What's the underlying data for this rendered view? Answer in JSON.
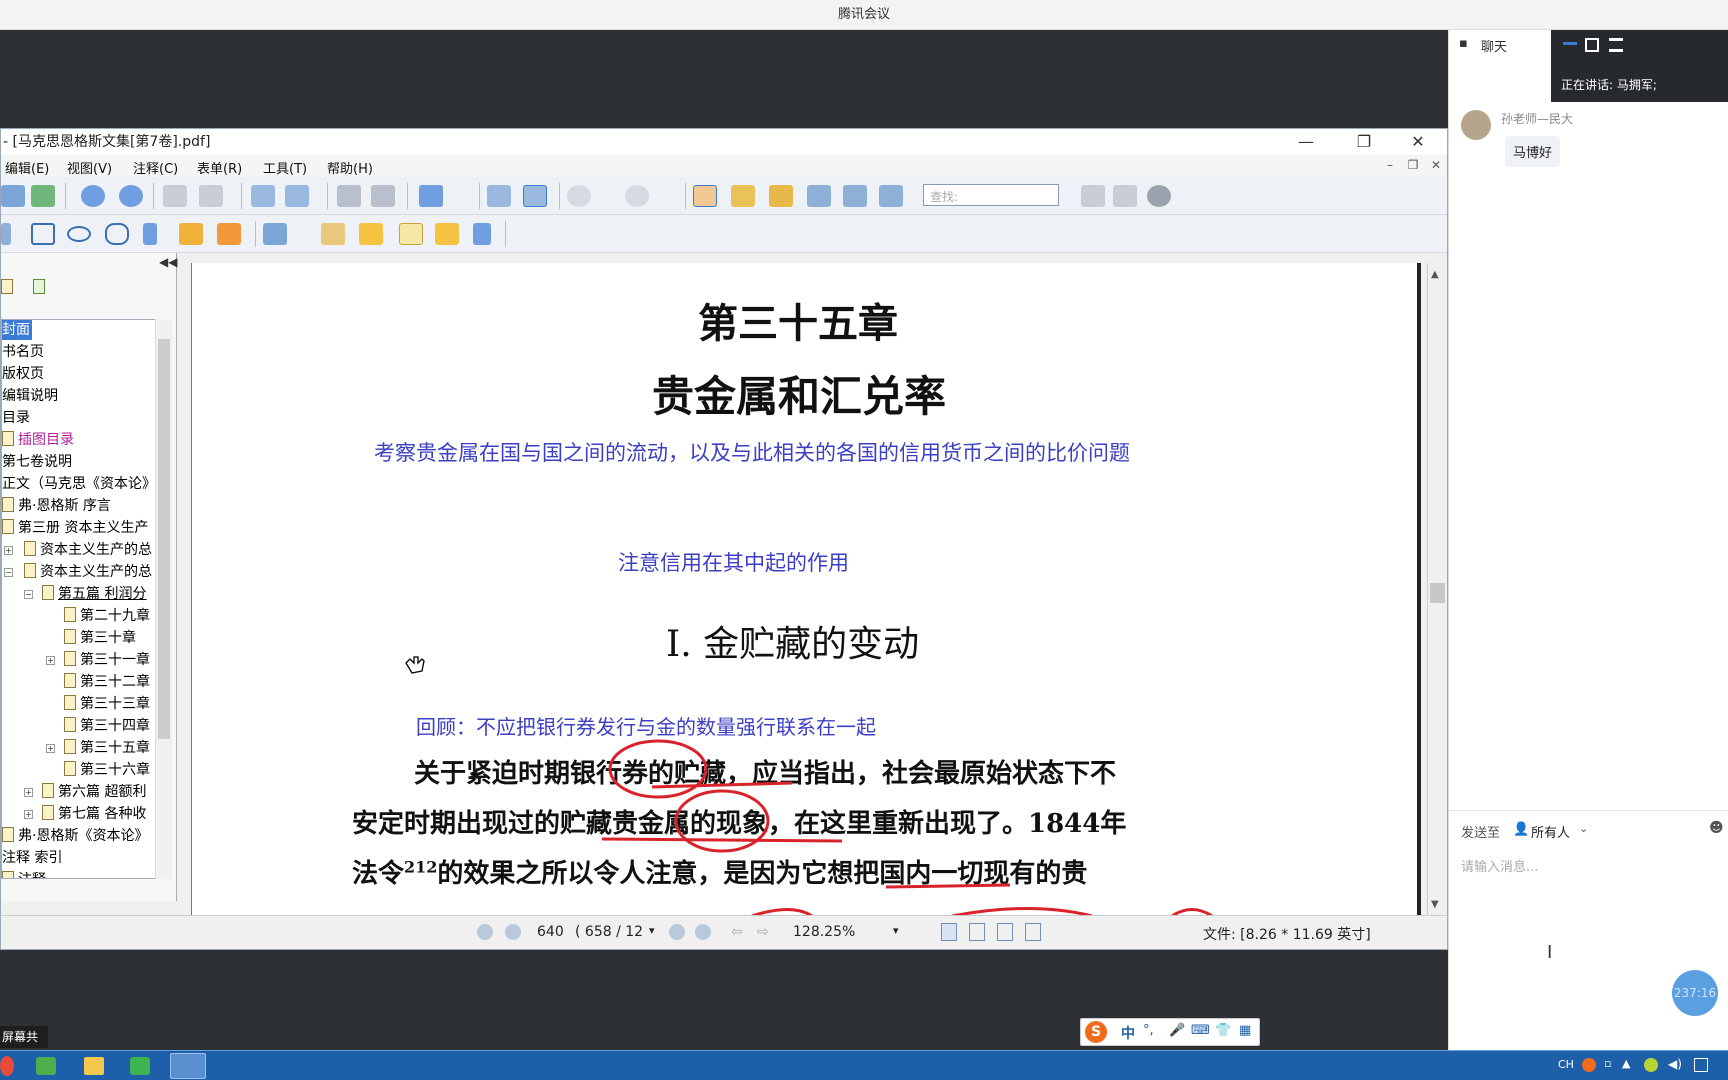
{
  "app_title": "腾讯会议",
  "pdf": {
    "window_title": "- [马克思恩格斯文集[第7卷].pdf]",
    "menu": [
      "编辑(E)",
      "视图(V)",
      "注释(C)",
      "表单(R)",
      "工具(T)",
      "帮助(H)"
    ],
    "search_placeholder": "查找:",
    "tree": [
      "封面",
      "书名页",
      "版权页",
      "编辑说明",
      "目录",
      "插图目录",
      "第七卷说明",
      "正文（马克思《资本论》",
      "弗·恩格斯  序言",
      "第三册  资本主义生产",
      "资本主义生产的总",
      "资本主义生产的总",
      "第五篇  利润分",
      "第二十九章",
      "第三十章",
      "第三十一章",
      "第三十二章",
      "第三十三章",
      "第三十四章",
      "第三十五章",
      "第三十六章",
      "第六篇  超额利",
      "第七篇  各种收",
      "弗·恩格斯《资本论》",
      "注释  索引",
      "注释"
    ],
    "doc": {
      "chapter": "第三十五章",
      "title": "贵金属和汇兑率",
      "note1": "考察贵金属在国与国之间的流动，以及与此相关的各国的信用货币之间的比价问题",
      "note2": "注意信用在其中起的作用",
      "section": "I. 金贮藏的变动",
      "note3": "回顾：不应把银行券发行与金的数量强行联系在一起",
      "line1": "关于紧迫时期银行券的贮藏，应当指出，社会最原始状态下不",
      "line2": "安定时期出现过的贮藏贵金属的现象，在这里重新出现了。1844年",
      "line3a": "法令",
      "line3sup": "212",
      "line3b": "的效果之所以令人注意，是因为它想把国内一切现有的贵"
    },
    "status": {
      "page": "640",
      "page_of": "( 658 / 12",
      "zoom": "128.25%",
      "file_info": "文件: [8.26 * 11.69 英寸]"
    }
  },
  "chat": {
    "tab_label": "聊天",
    "speaking_label": "正在讲话:  马拥军;",
    "sender": "孙老师—民大",
    "message": "马博好",
    "send_to_label": "发送至",
    "recipient": "所有人",
    "input_placeholder": "请输入消息..."
  },
  "timer": "237:16",
  "screen_share_label": "屏幕共享",
  "taskbar": {
    "lang": "CH"
  },
  "colors": {
    "accent": "#3b3fc4",
    "annotation_red": "#d8232a",
    "selected": "#3a7bd5"
  }
}
